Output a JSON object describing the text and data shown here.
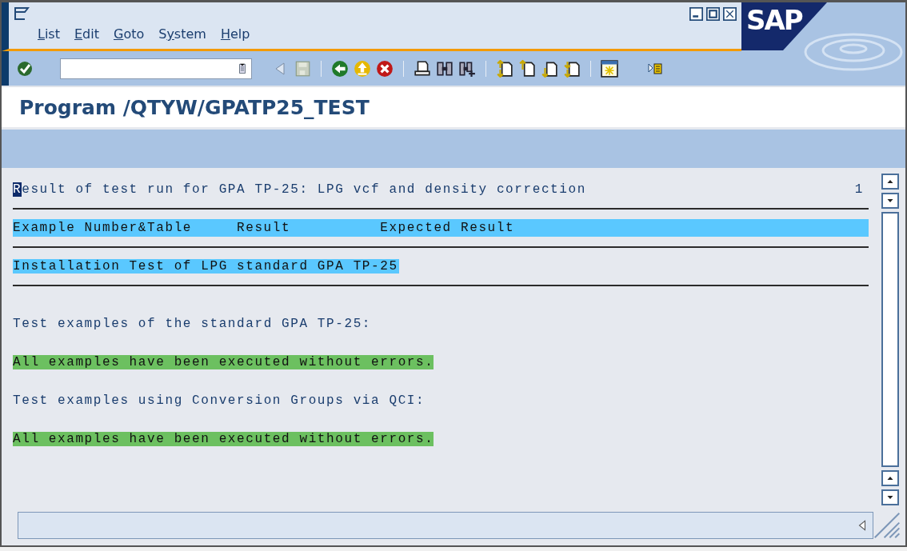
{
  "menu": [
    {
      "mnemonic": "L",
      "after": "ist"
    },
    {
      "mnemonic": "E",
      "after": "dit"
    },
    {
      "mnemonic": "G",
      "after": "oto"
    },
    {
      "before": "S",
      "mnemonic": "y",
      "after": "stem"
    },
    {
      "mnemonic": "H",
      "after": "elp"
    }
  ],
  "logo": "SAP",
  "title": "Program /QTYW/GPATP25_TEST",
  "list": {
    "page": "1",
    "lines": [
      {
        "kind": "title",
        "text": "Result of test run for GPA TP-25: LPG vcf and density correction",
        "cursor": true
      },
      {
        "kind": "rule"
      },
      {
        "kind": "header",
        "columns": [
          "Example Number&Table",
          "Result",
          "Expected Result"
        ]
      },
      {
        "kind": "rule"
      },
      {
        "kind": "highlight",
        "text": "Installation Test of LPG standard GPA TP-25"
      },
      {
        "kind": "rule"
      },
      {
        "kind": "blank"
      },
      {
        "kind": "text",
        "text": "Test examples of the standard GPA TP-25:"
      },
      {
        "kind": "blank"
      },
      {
        "kind": "success",
        "text": "All examples have been executed without errors."
      },
      {
        "kind": "blank"
      },
      {
        "kind": "text",
        "text": "Test examples using Conversion Groups via QCI:"
      },
      {
        "kind": "blank"
      },
      {
        "kind": "success",
        "text": "All examples have been executed without errors."
      }
    ]
  }
}
